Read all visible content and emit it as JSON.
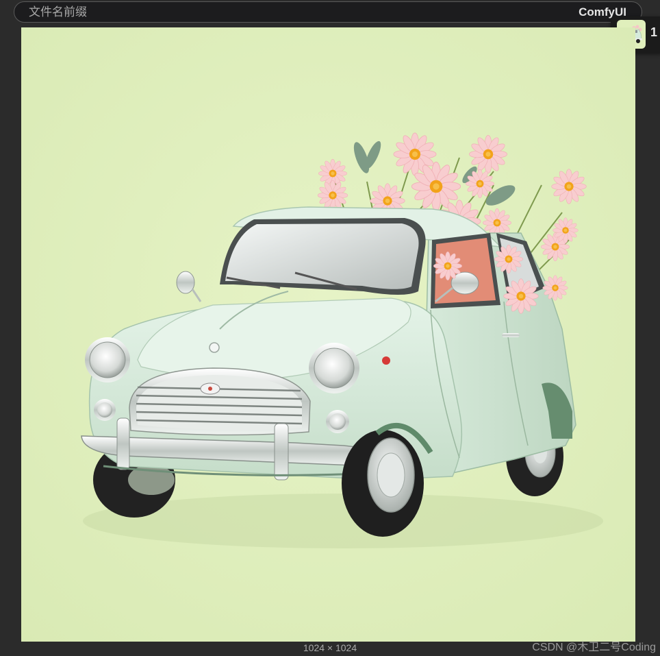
{
  "header": {
    "filename_prefix_placeholder": "文件名前缀",
    "brand": "ComfyUI"
  },
  "queue": {
    "count": "1"
  },
  "image_info": {
    "dimensions": "1024 × 1024"
  },
  "watermark": "CSDN @木卫二号Coding",
  "colors": {
    "background": "#2b2b2b",
    "topbar": "#1c1c1e",
    "image_backdrop": "#e0efbc",
    "car_body": "#d6ebdc",
    "flower_petal": "#f6c4c4",
    "flower_center": "#f2a31a"
  },
  "icons": {
    "preview": "generated-image",
    "queue": "image-thumbnail-icon"
  }
}
